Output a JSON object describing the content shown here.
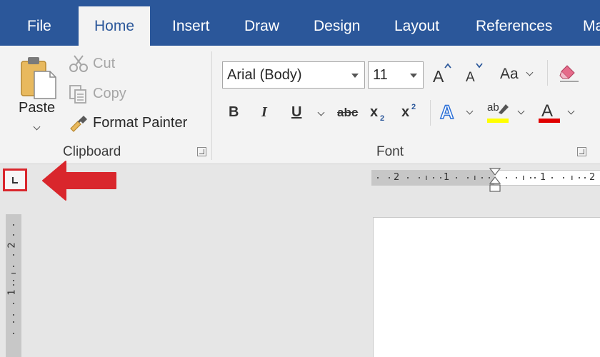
{
  "tabs": [
    "File",
    "Home",
    "Insert",
    "Draw",
    "Design",
    "Layout",
    "References",
    "Ma"
  ],
  "active_tab": "Home",
  "clipboard": {
    "paste_label": "Paste",
    "cut_label": "Cut",
    "copy_label": "Copy",
    "format_painter_label": "Format Painter",
    "group_label": "Clipboard"
  },
  "font": {
    "font_name": "Arial (Body)",
    "font_size": "11",
    "grow_label": "A",
    "shrink_label": "A",
    "case_label": "Aa",
    "bold_label": "B",
    "italic_label": "I",
    "underline_label": "U",
    "strike_label": "abc",
    "subscript_label": "x",
    "subscript_sub": "2",
    "superscript_label": "x",
    "superscript_sup": "2",
    "effects_label": "A",
    "highlight_label": "ab",
    "color_label": "A",
    "group_label": "Font"
  },
  "ruler": {
    "h_labels": [
      "2",
      "1",
      "1",
      "2"
    ],
    "v_labels": [
      "2",
      "1"
    ]
  },
  "colors": {
    "accent": "#2b579a",
    "highlight": "#ffff00",
    "font_color": "#e00000",
    "callout_arrow": "#d9262c"
  }
}
